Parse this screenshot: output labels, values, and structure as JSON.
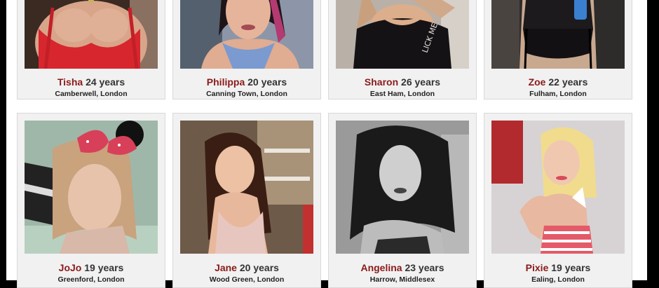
{
  "profiles_row1": [
    {
      "name": "Tisha",
      "age": "24 years",
      "location": "Camberwell, London"
    },
    {
      "name": "Philippa",
      "age": "20 years",
      "location": "Canning Town, London"
    },
    {
      "name": "Sharon",
      "age": "26 years",
      "location": "East Ham, London"
    },
    {
      "name": "Zoe",
      "age": "22 years",
      "location": "Fulham, London"
    }
  ],
  "profiles_row2": [
    {
      "name": "JoJo",
      "age": "19 years",
      "location": "Greenford, London"
    },
    {
      "name": "Jane",
      "age": "20 years",
      "location": "Wood Green, London"
    },
    {
      "name": "Angelina",
      "age": "23 years",
      "location": "Harrow, Middlesex"
    },
    {
      "name": "Pixie",
      "age": "19 years",
      "location": "Ealing, London"
    }
  ],
  "shirt_text": "LICK ME",
  "colors": {
    "name": "#8b1a1a",
    "card_bg": "#f1f1f1",
    "card_border": "#d9d9d9",
    "backdrop": "#000000"
  }
}
